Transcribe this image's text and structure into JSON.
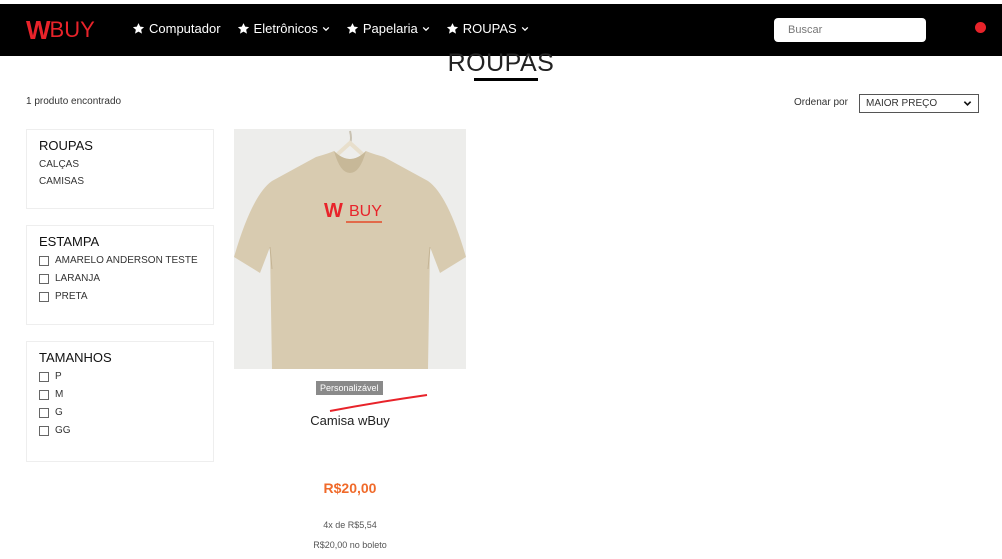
{
  "header": {
    "logo_w": "W",
    "logo_buy": "BUY",
    "nav": [
      {
        "label": "Computador",
        "has_dropdown": false
      },
      {
        "label": "Eletrônicos",
        "has_dropdown": true
      },
      {
        "label": "Papelaria",
        "has_dropdown": true
      },
      {
        "label": "ROUPAS",
        "has_dropdown": true
      }
    ],
    "search_placeholder": "Buscar",
    "accent_color": "#e8232a"
  },
  "page": {
    "title": "ROUPAS",
    "result_count": "1 produto encontrado",
    "sort_label": "Ordenar por",
    "sort_value": "MAIOR PREÇO"
  },
  "filters": {
    "categories": {
      "title": "ROUPAS",
      "items": [
        "CALÇAS",
        "CAMISAS"
      ]
    },
    "estampa": {
      "title": "ESTAMPA",
      "items": [
        "AMARELO ANDERSON TESTE",
        "LARANJA",
        "PRETA"
      ]
    },
    "tamanhos": {
      "title": "TAMANHOS",
      "items": [
        "P",
        "M",
        "G",
        "GG"
      ]
    }
  },
  "product": {
    "badge": "Personalizável",
    "name": "Camisa wBuy",
    "price": "R$20,00",
    "installments": "4x de R$5,54",
    "boleto": "R$20,00 no boleto",
    "shirt_logo_w": "W",
    "shirt_logo_buy": "BUY",
    "price_color": "#f06a2a"
  }
}
